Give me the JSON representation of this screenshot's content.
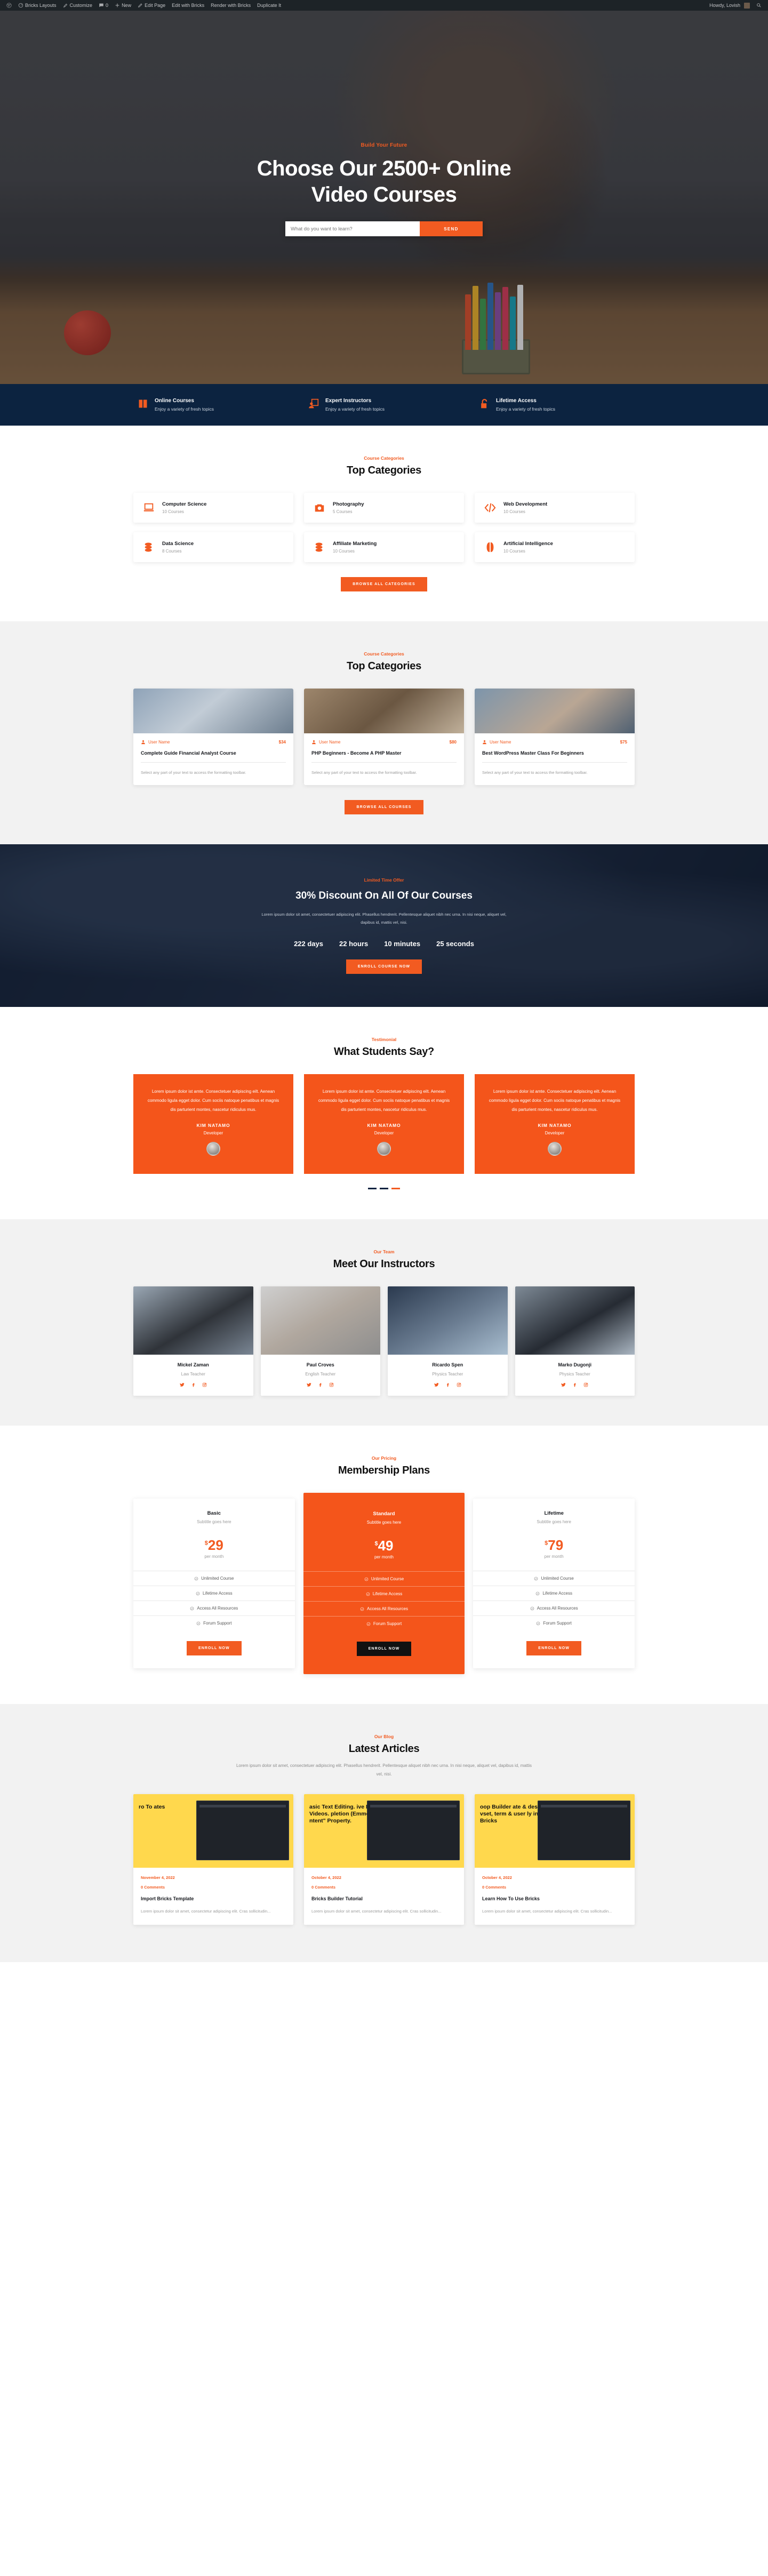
{
  "adminbar": {
    "items": [
      {
        "label": "Bricks Layouts",
        "icon": "dashboard-icon"
      },
      {
        "label": "Customize",
        "icon": "brush-icon"
      },
      {
        "label": "0",
        "icon": "comment-icon"
      },
      {
        "label": "New",
        "icon": "plus-icon"
      },
      {
        "label": "Edit Page",
        "icon": "pencil-icon"
      },
      {
        "label": "Edit with Bricks",
        "icon": "none"
      },
      {
        "label": "Render with Bricks",
        "icon": "none"
      },
      {
        "label": "Duplicate It",
        "icon": "none"
      }
    ],
    "wp_logo": "wordpress-icon",
    "greeting": "Howdy, Lovish",
    "search_icon": "search-icon"
  },
  "hero": {
    "eyebrow": "Build Your Future",
    "title_line1": "Choose Our 2500+ Online",
    "title_line2": "Video Courses",
    "search_placeholder": "What do you want to learn?",
    "search_value": "",
    "send_label": "SEND"
  },
  "features": [
    {
      "icon": "book-icon",
      "title": "Online Courses",
      "subtitle": "Enjoy a variety of fresh topics"
    },
    {
      "icon": "instructor-icon",
      "title": "Expert Instructors",
      "subtitle": "Enjoy a variety of fresh topics"
    },
    {
      "icon": "unlock-icon",
      "title": "Lifetime Access",
      "subtitle": "Enjoy a variety of fresh topics"
    }
  ],
  "categories": {
    "eyebrow": "Course Categories",
    "title": "Top Categories",
    "items": [
      {
        "icon": "laptop-icon",
        "name": "Computer Science",
        "count": "10 Courses"
      },
      {
        "icon": "camera-icon",
        "name": "Photography",
        "count": "5 Courses"
      },
      {
        "icon": "code-icon",
        "name": "Web Development",
        "count": "10 Courses"
      },
      {
        "icon": "coins-icon",
        "name": "Data Science",
        "count": "8 Courses"
      },
      {
        "icon": "coins-icon",
        "name": "Affiliate Marketing",
        "count": "10 Courses"
      },
      {
        "icon": "brain-icon",
        "name": "Artificial Intelligence",
        "count": "10 Courses"
      }
    ],
    "button": "BROWSE ALL CATEGORIES"
  },
  "courses": {
    "eyebrow": "Course Categories",
    "title": "Top Categories",
    "items": [
      {
        "author": "User Name",
        "price": "$34",
        "title": "Complete Guide Financial Analyst Course",
        "desc": "Select any part of your text to access the formatting toolbar."
      },
      {
        "author": "User Name",
        "price": "$80",
        "title": "PHP Beginners - Become A PHP Master",
        "desc": "Select any part of your text to access the formatting toolbar."
      },
      {
        "author": "User Name",
        "price": "$75",
        "title": "Best WordPress Master Class For Beginners",
        "desc": "Select any part of your text to access the formatting toolbar."
      }
    ],
    "button": "BROWSE ALL COURSES"
  },
  "discount": {
    "eyebrow": "Limited Time Offer",
    "title": "30% Discount On All Of Our Courses",
    "desc": "Lorem ipsum dolor sit amet, consectetuer adipiscing elit. Phasellus hendrerit. Pellentesque aliquet nibh nec urna. In nisi neque, aliquet vel, dapibus id, mattis vel, nisi.",
    "counters": [
      "222 days",
      "22 hours",
      "10 minutes",
      "25 seconds"
    ],
    "button": "ENROLL COURSE NOW"
  },
  "testimonials": {
    "eyebrow": "Testimonial",
    "title": "What Students Say?",
    "items": [
      {
        "quote": "Lorem ipsum dolor ist amte. Consectetuer adipiscing eilt. Aenean commodo ligula egget dolor. Cum sociis natoque penatibus et magnis dis parturient montes, nascetur ridiculus mus.",
        "name": "KIM NATAMO",
        "role": "Developer"
      },
      {
        "quote": "Lorem ipsum dolor ist amte. Consectetuer adipiscing eilt. Aenean commodo ligula egget dolor. Cum sociis natoque penatibus et magnis dis parturient montes, nascetur ridiculus mus.",
        "name": "KIM NATAMO",
        "role": "Developer"
      },
      {
        "quote": "Lorem ipsum dolor ist amte. Consectetuer adipiscing eilt. Aenean commodo ligula egget dolor. Cum sociis natoque penatibus et magnis dis parturient montes, nascetur ridiculus mus.",
        "name": "KIM NATAMO",
        "role": "Developer"
      }
    ]
  },
  "instructors": {
    "eyebrow": "Our Team",
    "title": "Meet Our Instructors",
    "items": [
      {
        "name": "Mickel Zaman",
        "role": "Law Teacher"
      },
      {
        "name": "Paul Croves",
        "role": "English Teacher"
      },
      {
        "name": "Ricardo Spen",
        "role": "Physics Teacher"
      },
      {
        "name": "Marko Dugonji",
        "role": "Physics Teacher"
      }
    ],
    "social_icons": [
      "twitter-icon",
      "facebook-icon",
      "instagram-icon"
    ]
  },
  "pricing": {
    "eyebrow": "Our Pricing",
    "title": "Membership Plans",
    "plans": [
      {
        "name": "Basic",
        "subtitle": "Subtitle goes here",
        "currency": "$",
        "price": "29",
        "period": "per month",
        "features": [
          "Unlimited Course",
          "Lifetime Access",
          "Access All Resources",
          "Forum Support"
        ],
        "button": "ENROLL NOW",
        "featured": false
      },
      {
        "name": "Standard",
        "subtitle": "Subtitle goes here",
        "currency": "$",
        "price": "49",
        "period": "per month",
        "features": [
          "Unlimited Course",
          "Lifetime Access",
          "Access All Resources",
          "Forum Support"
        ],
        "button": "ENROLL NOW",
        "featured": true
      },
      {
        "name": "Lifetime",
        "subtitle": "Subtitle goes here",
        "currency": "$",
        "price": "79",
        "period": "per month",
        "features": [
          "Unlimited Course",
          "Lifetime Access",
          "Access All Resources",
          "Forum Support"
        ],
        "button": "ENROLL NOW",
        "featured": false
      }
    ]
  },
  "blog": {
    "eyebrow": "Our Blog",
    "title": "Latest Articles",
    "desc": "Lorem ipsum dolor sit amet, consectetuer adipiscing elit. Phasellus hendrerit. Pellentesque aliquet nibh nec urna. In nisi neque, aliquet vel, dapibus id, mattis vel, nisi.",
    "posts": [
      {
        "overlay": "ro To ates",
        "date": "November 4, 2022",
        "comments": "0 Comments",
        "title": "Import Bricks Template",
        "excerpt": "Lorem ipsum dolor sit amet, consectetur adipiscing elit. Cras sollicitudin..."
      },
      {
        "overlay": "asic Text Editing. ive BG Videos. pletion (Emmet). ntent\" Property.",
        "date": "October 4, 2022",
        "comments": "0 Comments",
        "title": "Bricks Builder Tutorial",
        "excerpt": "Lorem ipsum dolor sit amet, consectetur adipiscing elit. Cras sollicitudin..."
      },
      {
        "overlay": "oop Builder ate & design vset, term & user ly in Bricks",
        "date": "October 4, 2022",
        "comments": "0 Comments",
        "title": "Learn How To Use Bricks",
        "excerpt": "Lorem ipsum dolor sit amet, consectetur adipiscing elit. Cras sollicitudin..."
      }
    ]
  },
  "colors": {
    "accent": "#f25b21",
    "navy": "#0c2340",
    "dark": "#1d2327"
  }
}
